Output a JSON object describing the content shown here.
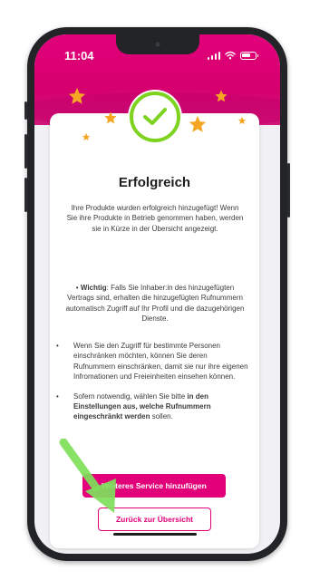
{
  "status_bar": {
    "time": "11:04"
  },
  "success_card": {
    "title": "Erfolgreich",
    "intro": "Ihre Produkte wurden erfolgreich hinzugefügt! Wenn Sie ihre Produkte in Betrieb genommen haben, werden sie in Kürze in der Übersicht angezeigt.",
    "important_label": "Wichtig",
    "important_text": ": Falls Sie Inhaber:in des hinzugefügten Vertrags sind, erhalten die hinzugefügten Rufnummern automatisch Zugriff auf Ihr Profil und die dazugehörigen Dienste.",
    "bullets": [
      {
        "text": "Wenn Sie den Zugriff für bestimmte Personen einschränken möchten, können Sie deren Rufnummern einschränken, damit sie nur ihre eigenen Infromationen und Freieinheiten einsehen können."
      },
      {
        "text_before": "Sofern notwendig, wählen Sie bitte ",
        "text_bold": "in den Einstellungen aus, welche Rufnummern eingeschränkt werden",
        "text_after": " sollen."
      }
    ],
    "bullet_symbol": "•",
    "primary_button": "Weiteres Service hinzufügen",
    "secondary_button": "Zurück zur Übersicht"
  },
  "colors": {
    "brand_magenta": "#e2007a",
    "success_green": "#7ed321",
    "star_orange": "#f5a623",
    "highlight_arrow": "#7ee05a"
  },
  "icons": [
    "check-icon",
    "star-icon",
    "wifi-icon",
    "signal-icon",
    "battery-icon",
    "camera-dot-icon",
    "arrow-pointer-icon"
  ]
}
